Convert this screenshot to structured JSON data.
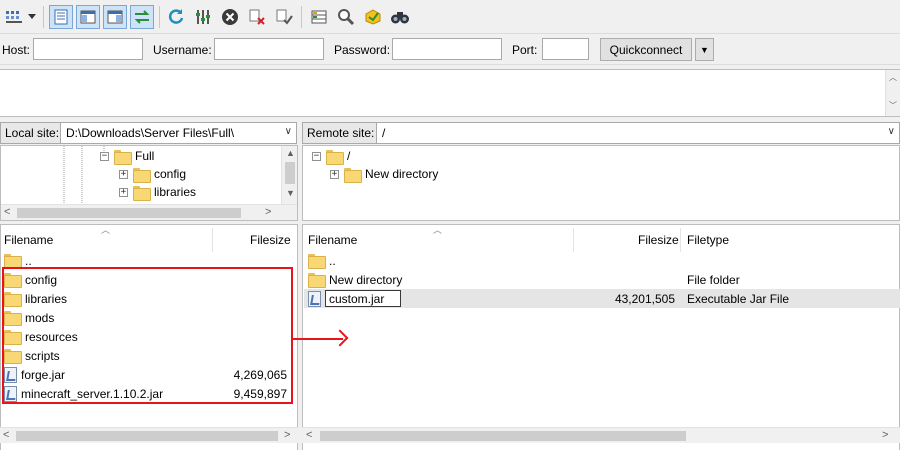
{
  "toolbar": {
    "buttons": [
      {
        "icon": "site-manager-icon"
      },
      {
        "icon": "dropdown-arrow-icon"
      },
      {
        "icon": "message-log-icon"
      },
      {
        "icon": "local-tree-icon"
      },
      {
        "icon": "remote-tree-icon"
      },
      {
        "icon": "transfer-queue-icon"
      },
      {
        "icon": "refresh-icon"
      },
      {
        "icon": "process-queue-icon"
      },
      {
        "icon": "cancel-icon"
      },
      {
        "icon": "disconnect-icon"
      },
      {
        "icon": "reconnect-icon"
      },
      {
        "icon": "filter-icon"
      },
      {
        "icon": "compare-icon"
      },
      {
        "icon": "sync-browse-icon"
      },
      {
        "icon": "search-icon"
      }
    ]
  },
  "quickconnect": {
    "host_label": "Host:",
    "host_value": "",
    "username_label": "Username:",
    "username_value": "",
    "password_label": "Password:",
    "password_value": "",
    "port_label": "Port:",
    "port_value": "",
    "button_label": "Quickconnect",
    "dropdown_glyph": "▼"
  },
  "local": {
    "site_label": "Local site:",
    "path": "D:\\Downloads\\Server Files\\Full\\",
    "tree": [
      {
        "label": "Full",
        "expander": "−"
      },
      {
        "label": "config",
        "expander": "+"
      },
      {
        "label": "libraries",
        "expander": "+"
      }
    ],
    "columns": {
      "filename": "Filename",
      "filesize": "Filesize"
    },
    "files": [
      {
        "name": "..",
        "type": "folder",
        "size": ""
      },
      {
        "name": "config",
        "type": "folder",
        "size": ""
      },
      {
        "name": "libraries",
        "type": "folder",
        "size": ""
      },
      {
        "name": "mods",
        "type": "folder",
        "size": ""
      },
      {
        "name": "resources",
        "type": "folder",
        "size": ""
      },
      {
        "name": "scripts",
        "type": "folder",
        "size": ""
      },
      {
        "name": "forge.jar",
        "type": "jar",
        "size": "4,269,065"
      },
      {
        "name": "minecraft_server.1.10.2.jar",
        "type": "jar",
        "size": "9,459,897"
      }
    ]
  },
  "remote": {
    "site_label": "Remote site:",
    "path": "/",
    "tree": [
      {
        "label": "/",
        "expander": "−"
      },
      {
        "label": "New directory",
        "expander": "+"
      }
    ],
    "columns": {
      "filename": "Filename",
      "filesize": "Filesize",
      "filetype": "Filetype"
    },
    "files": [
      {
        "name": "..",
        "type": "folder",
        "size": "",
        "filetype": ""
      },
      {
        "name": "New directory",
        "type": "folder",
        "size": "",
        "filetype": "File folder"
      },
      {
        "name": "custom.jar",
        "type": "jar",
        "size": "43,201,505",
        "filetype": "Executable Jar File"
      }
    ]
  },
  "colors": {
    "highlight": "#e8141b",
    "folder": "#f8d775",
    "active_button": "#cde3f7"
  }
}
